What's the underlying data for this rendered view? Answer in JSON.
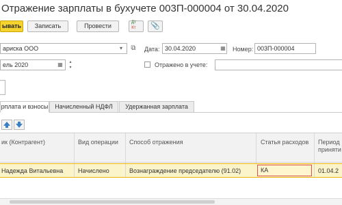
{
  "window": {
    "title": "Отражение зарплаты в бухучете 003П-000004 от 30.04.2020"
  },
  "toolbar": {
    "post_close_label": "ывать",
    "save_label": "Записать",
    "post_label": "Провести",
    "dt_kt_label": "Дт Кт"
  },
  "header": {
    "org_value": "ариска ООО",
    "date_label": "Дата:",
    "date_value": "30.04.2020",
    "number_label": "Номер:",
    "number_value": "003П-000004",
    "period_value": "ель 2020",
    "reflected_label": "Отражено в учете:"
  },
  "tabs": [
    {
      "label": "рплата и взносы"
    },
    {
      "label": "Начисленный НДФЛ"
    },
    {
      "label": "Удержанная зарплата"
    }
  ],
  "table": {
    "columns": [
      "ик (Контрагент)",
      "Вид операции",
      "Способ отражения",
      "Статья расходов",
      "Период",
      "приняти"
    ],
    "rows": [
      {
        "employee": "Надежда Витальевна",
        "operation": "Начислено",
        "method": "Вознаграждение председателю (91.02)",
        "expense": "КА",
        "period": "01.04.2"
      }
    ]
  },
  "colors": {
    "accent": "#f5d42f",
    "selected_row": "#fbf3c9",
    "error_border": "#d9534f"
  }
}
